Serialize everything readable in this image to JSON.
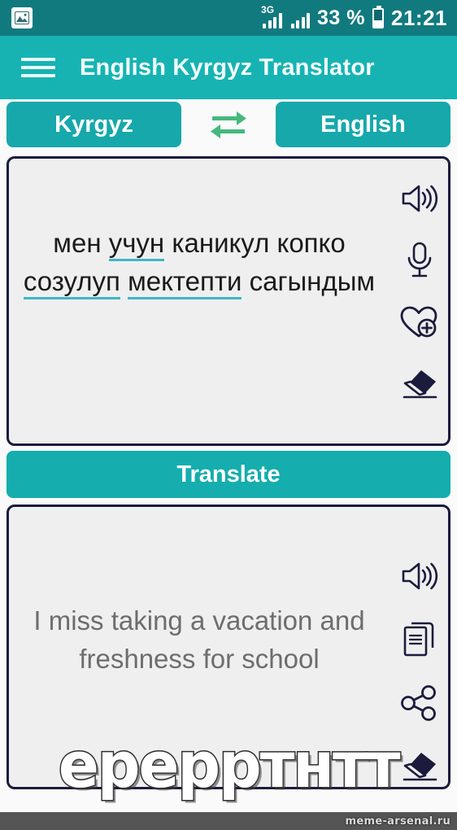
{
  "status_bar": {
    "photo_icon": "image-icon",
    "network_label": "3G",
    "signal_icon_1": "signal-bars-3g-icon",
    "signal_icon_2": "signal-bars-icon",
    "battery_percent": "33 %",
    "battery_icon": "battery-icon",
    "time": "21:21"
  },
  "app_bar": {
    "menu_icon": "hamburger-menu-icon",
    "title": "English Kyrgyz Translator"
  },
  "language_bar": {
    "source_language": "Kyrgyz",
    "swap_icon": "swap-arrows-icon",
    "target_language": "English"
  },
  "input_panel": {
    "text_parts": [
      {
        "text": "мен ",
        "spellcheck": false
      },
      {
        "text": "учун",
        "spellcheck": true
      },
      {
        "text": " каникул копко ",
        "spellcheck": false
      },
      {
        "text": "созулуп",
        "spellcheck": true
      },
      {
        "text": " ",
        "spellcheck": false
      },
      {
        "text": "мектепти",
        "spellcheck": true
      },
      {
        "text": " сагындым",
        "spellcheck": false
      }
    ],
    "full_text": "мен учун каникул копко созулуп мектепти сагындым",
    "icons": [
      {
        "name": "speaker-icon",
        "label": "Listen"
      },
      {
        "name": "microphone-icon",
        "label": "Voice input"
      },
      {
        "name": "favorite-add-icon",
        "label": "Add to favorites"
      },
      {
        "name": "eraser-icon",
        "label": "Clear"
      }
    ]
  },
  "translate_button": {
    "label": "Translate"
  },
  "output_panel": {
    "text": "I miss taking a vacation and freshness for school",
    "icons": [
      {
        "name": "speaker-icon",
        "label": "Listen"
      },
      {
        "name": "copy-icon",
        "label": "Copy"
      },
      {
        "name": "share-icon",
        "label": "Share"
      },
      {
        "name": "eraser-icon",
        "label": "Clear"
      }
    ]
  },
  "meme": {
    "caption": "ерерртнтт",
    "watermark": "meme-arsenal.ru"
  },
  "colors": {
    "status_bar": "#117a7f",
    "app_bar": "#17b3b3",
    "button_teal": "#17a8ab",
    "swap_green": "#45b87c",
    "panel_border": "#1b1b3d",
    "panel_fill": "#efefef",
    "spellcheck_underline": "#3fb6c8",
    "output_text": "#6d6d6d",
    "bottom_bar": "#555555"
  }
}
